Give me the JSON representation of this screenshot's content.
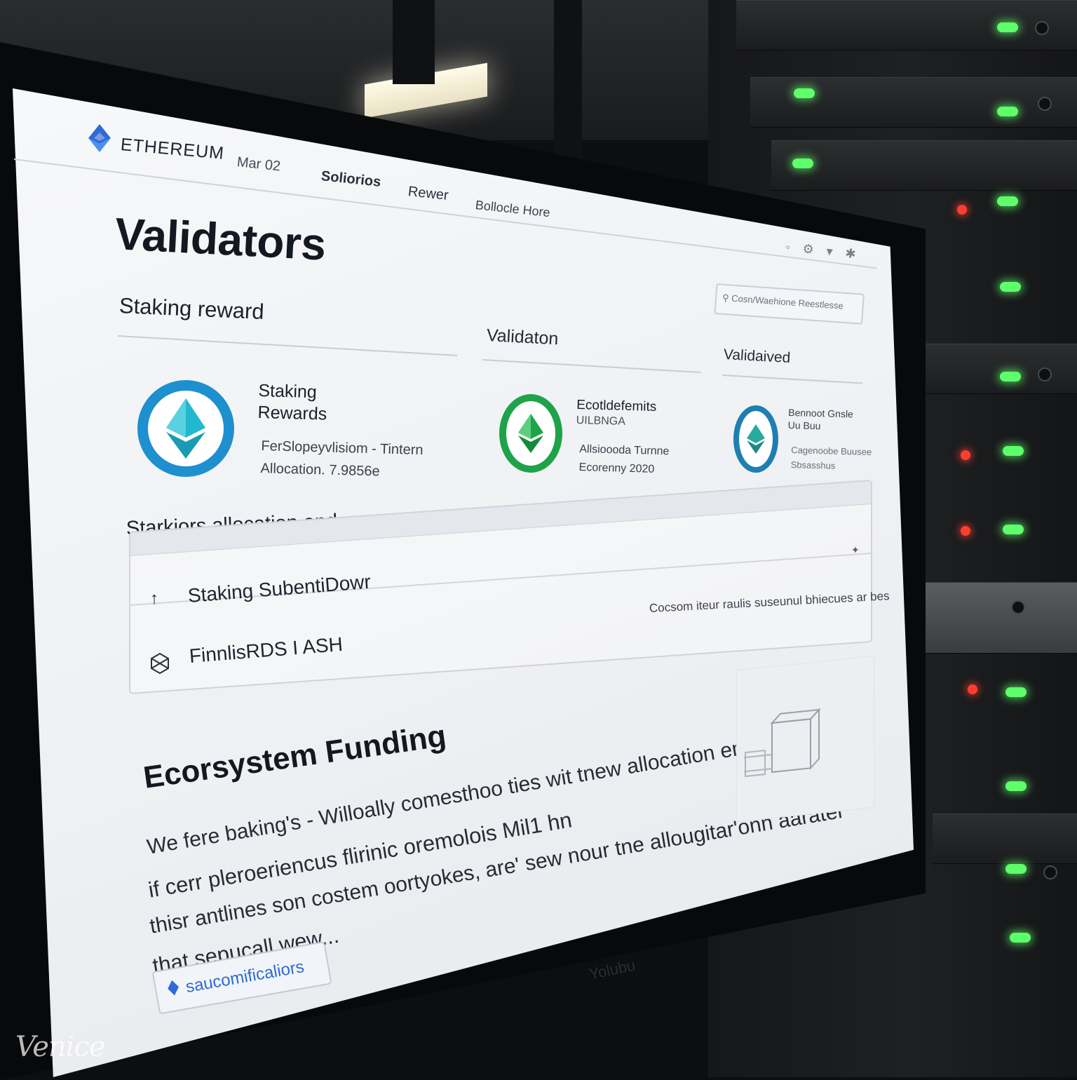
{
  "header": {
    "brand": "ETHEREUM",
    "date": "Mar 02",
    "nav": [
      "Soliorios",
      "Rewer",
      "Bollocle Hore"
    ]
  },
  "toolbar": {
    "search_text": "Cosn/Waehione   Reestlesse"
  },
  "page": {
    "title": "Validators"
  },
  "staking": {
    "heading": "Staking reward",
    "columns": [
      "Validaton",
      "Validaived"
    ],
    "cards": [
      {
        "title_line1": "Staking",
        "title_line2": "Rewards",
        "line1": "FerSlopeyvlisiom - Tintern",
        "line2": "Allocation. 7.9856e",
        "ring_color": "#1e8fcf",
        "gem_color": "#22b8cf"
      },
      {
        "title_line1": "Ecotldefemits",
        "title_line2": "UILBNGA",
        "line1": "Allsioooda Turnne",
        "line2": "Ecorenny 2020",
        "ring_color": "#1ea34a",
        "gem_color": "#1ea34a"
      },
      {
        "title_line1": "Bennoot Gnsle",
        "title_line2": "Uu Buu",
        "line1": "Cagenoobe Buusee",
        "line2": "Sbsasshus",
        "ring_color": "#1e7fb0",
        "gem_color": "#27a9a0"
      }
    ]
  },
  "allocation": {
    "heading": "Starkiors allocation and",
    "rows": [
      {
        "label": "Staking SubentiDowr",
        "icon": "arrow-up-icon"
      },
      {
        "label": "FinnlisRDS I ASH",
        "icon": "cube-icon"
      }
    ],
    "note": "Cocsom iteur raulis suseunul bhiecues ar bes"
  },
  "ecosystem": {
    "title": "Ecorsystem Funding",
    "lines": [
      "We fere baking's - Willoally comesthoo ties wit tnew allocation ened afwae",
      "if cerr pleroeriencus flirinic oremolois Mil1 hn",
      "thisr antlines son costem oortyokes, are' sew nour tne allougitar'onn aarater",
      "that sepucall wew..."
    ],
    "cta": "saucomificaliors"
  },
  "watermark": "Venice",
  "colors": {
    "eth_blue": "#2f6ad6",
    "led_green": "#5dff6a",
    "led_red": "#ff3d2e"
  }
}
